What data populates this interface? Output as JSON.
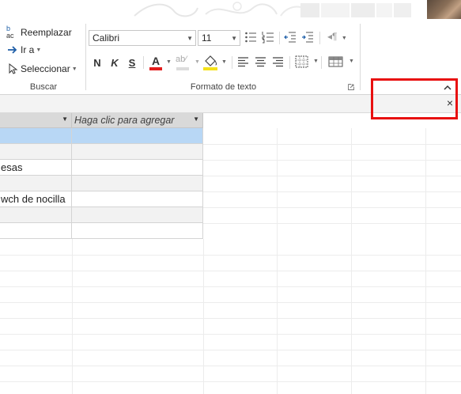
{
  "ribbon": {
    "buscar": {
      "replace_label": "Reemplazar",
      "goto_label": "Ir a",
      "select_label": "Seleccionar",
      "group_label": "Buscar"
    },
    "format": {
      "font_name": "Calibri",
      "font_size": "11",
      "bold": "N",
      "italic": "K",
      "underline": "S",
      "font_color_letter": "A",
      "group_label": "Formato de texto",
      "font_color_bar": "#e31c1c",
      "highlight_bar": "#f5e21a"
    }
  },
  "window_controls": {
    "collapse_icon": "^",
    "close_icon": "×"
  },
  "colors": {
    "selection_row": "#b8d7f5",
    "alt_row": "#f2f2f2",
    "header_bg": "#d9d9d9",
    "annotation": "#e81010"
  },
  "datasheet": {
    "headers": [
      "",
      "Haga clic para agregar"
    ],
    "rows": [
      {
        "c1": "",
        "selected": true
      },
      {
        "c1": ""
      },
      {
        "c1": "esas"
      },
      {
        "c1": ""
      },
      {
        "c1": "wch de nocilla"
      },
      {
        "c1": ""
      },
      {
        "c1": ""
      }
    ]
  }
}
